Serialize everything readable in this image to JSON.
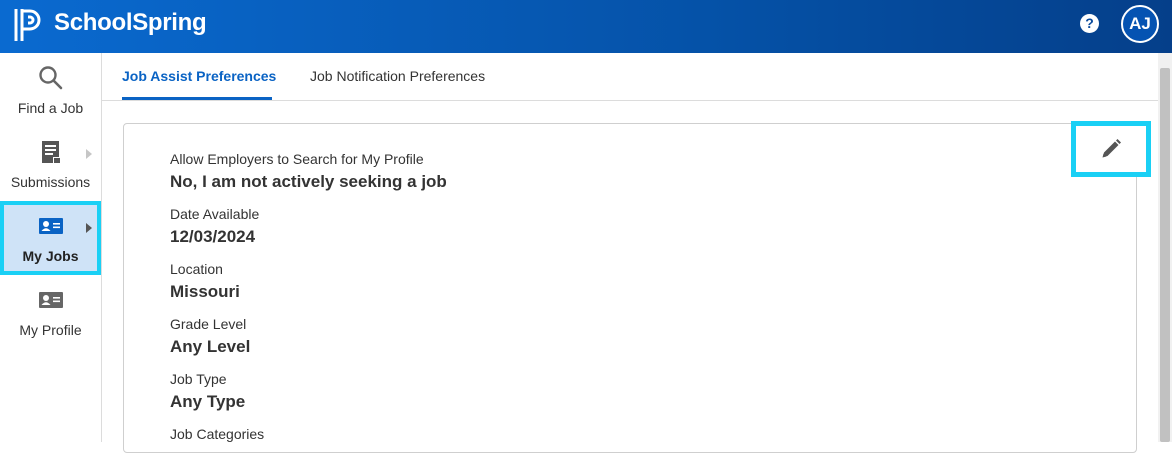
{
  "header": {
    "brand": "SchoolSpring",
    "help_symbol": "?",
    "avatar_initials": "AJ",
    "colors": {
      "bar_start": "#0a6ad0",
      "bar_end": "#053f8a",
      "highlight": "#1ad0f5",
      "accent": "#0a63c4"
    }
  },
  "sidebar": {
    "items": [
      {
        "label": "Find a Job",
        "icon": "search-icon",
        "active": false
      },
      {
        "label": "Submissions",
        "icon": "document-icon",
        "active": false
      },
      {
        "label": "My Jobs",
        "icon": "id-card-icon",
        "active": true
      },
      {
        "label": "My Profile",
        "icon": "id-card-icon",
        "active": false
      }
    ]
  },
  "tabs": [
    {
      "label": "Job Assist Preferences",
      "active": true
    },
    {
      "label": "Job Notification Preferences",
      "active": false
    }
  ],
  "card": {
    "edit_icon": "pencil-icon",
    "fields": [
      {
        "label": "Allow Employers to Search for My Profile",
        "value": "No, I am not actively seeking a job"
      },
      {
        "label": "Date Available",
        "value": "12/03/2024"
      },
      {
        "label": "Location",
        "value": "Missouri"
      },
      {
        "label": "Grade Level",
        "value": "Any Level"
      },
      {
        "label": "Job Type",
        "value": "Any Type"
      },
      {
        "label": "Job Categories",
        "value": ""
      }
    ]
  }
}
